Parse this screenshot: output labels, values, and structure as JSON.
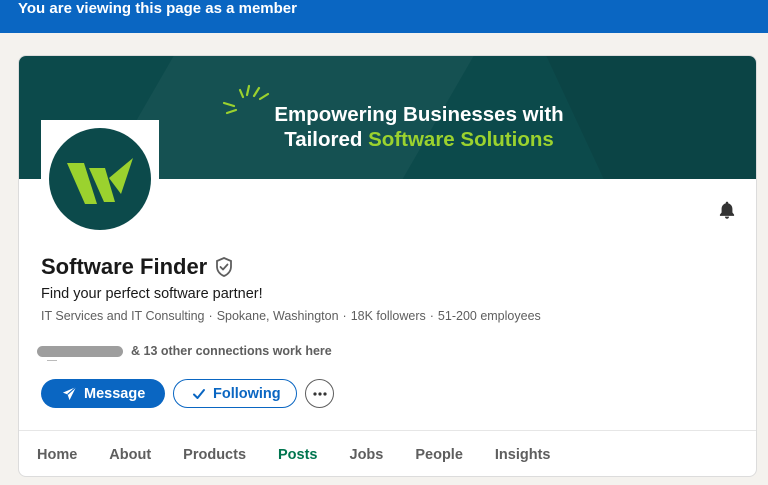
{
  "member_banner": {
    "text": "You are viewing this page as a member"
  },
  "cover": {
    "headline_line1": "Empowering Businesses with",
    "headline_line2_prefix": "Tailored ",
    "headline_line2_accent": "Software Solutions",
    "background_color": "#0c4a4b",
    "accent_color": "#9bd22e"
  },
  "company": {
    "name": "Software Finder",
    "verified_icon": "verified-shield-icon",
    "tagline": "Find your perfect software partner!",
    "industry": "IT Services and IT Consulting",
    "location": "Spokane, Washington",
    "followers": "18K followers",
    "employees": "51-200 employees",
    "separator": "·"
  },
  "connections": {
    "text": "& 13 other connections work here"
  },
  "actions": {
    "message_label": "Message",
    "following_label": "Following",
    "more_icon": "more-horizontal-icon"
  },
  "tabs": [
    {
      "label": "Home",
      "active": false
    },
    {
      "label": "About",
      "active": false
    },
    {
      "label": "Products",
      "active": false
    },
    {
      "label": "Posts",
      "active": true
    },
    {
      "label": "Jobs",
      "active": false
    },
    {
      "label": "People",
      "active": false
    },
    {
      "label": "Insights",
      "active": false
    }
  ],
  "colors": {
    "primary_blue": "#0a66c2",
    "active_tab_green": "#01754f",
    "text_dark": "#191919",
    "text_muted": "#5e5e5e"
  }
}
